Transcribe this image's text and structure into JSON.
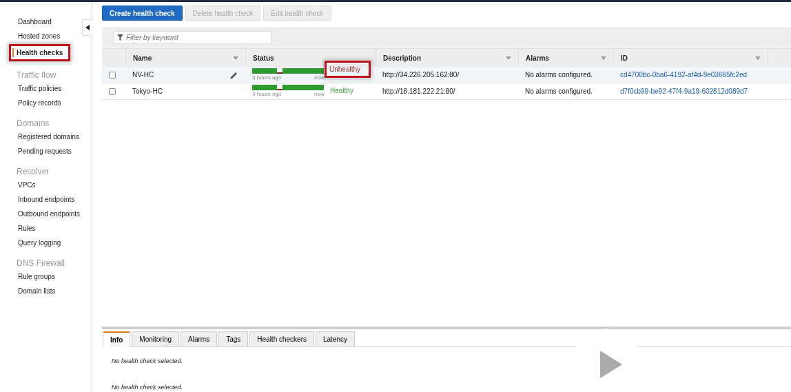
{
  "sidebar": {
    "items": [
      {
        "kind": "link",
        "label": "Dashboard",
        "selected": false,
        "highlighted": false
      },
      {
        "kind": "link",
        "label": "Hosted zones",
        "selected": false,
        "highlighted": false
      },
      {
        "kind": "link",
        "label": "Health checks",
        "selected": true,
        "highlighted": true
      },
      {
        "kind": "heading",
        "label": "Traffic flow"
      },
      {
        "kind": "link",
        "label": "Traffic policies",
        "selected": false,
        "highlighted": false
      },
      {
        "kind": "link",
        "label": "Policy records",
        "selected": false,
        "highlighted": false
      },
      {
        "kind": "heading",
        "label": "Domains"
      },
      {
        "kind": "link",
        "label": "Registered domains",
        "selected": false,
        "highlighted": false
      },
      {
        "kind": "link",
        "label": "Pending requests",
        "selected": false,
        "highlighted": false
      },
      {
        "kind": "heading",
        "label": "Resolver"
      },
      {
        "kind": "link",
        "label": "VPCs",
        "selected": false,
        "highlighted": false
      },
      {
        "kind": "link",
        "label": "Inbound endpoints",
        "selected": false,
        "highlighted": false
      },
      {
        "kind": "link",
        "label": "Outbound endpoints",
        "selected": false,
        "highlighted": false
      },
      {
        "kind": "link",
        "label": "Rules",
        "selected": false,
        "highlighted": false
      },
      {
        "kind": "link",
        "label": "Query logging",
        "selected": false,
        "highlighted": false
      },
      {
        "kind": "heading",
        "label": "DNS Firewall"
      },
      {
        "kind": "link",
        "label": "Rule groups",
        "selected": false,
        "highlighted": false
      },
      {
        "kind": "link",
        "label": "Domain lists",
        "selected": false,
        "highlighted": false
      }
    ]
  },
  "toolbar": {
    "buttons": [
      {
        "label": "Create health check",
        "disabled": false
      },
      {
        "label": "Delete health check",
        "disabled": true
      },
      {
        "label": "Edit health check",
        "disabled": true
      }
    ]
  },
  "filter": {
    "placeholder": "Filter by keyword"
  },
  "table": {
    "columns": [
      "Name",
      "Status",
      "Description",
      "Alarms",
      "ID"
    ],
    "rows": [
      {
        "checked": false,
        "name": "NV-HC",
        "editable": true,
        "status": {
          "kind": "unhealthy",
          "label": "Unhealthy",
          "highlighted": true,
          "from": "3 hours ago",
          "to": "now"
        },
        "description": "http://34.226.205.162:80/",
        "alarms": "No alarms configured.",
        "id": "cd4700bc-0ba6-4192-af4d-9e03665fc2ed"
      },
      {
        "checked": false,
        "name": "Tokyo-HC",
        "editable": false,
        "status": {
          "kind": "healthy",
          "label": "Healthy",
          "highlighted": false,
          "from": "3 hours ago",
          "to": "now"
        },
        "description": "http://18.181.222.21:80/",
        "alarms": "No alarms configured.",
        "id": "d7f0cb99-be92-47f4-9a19-602812d089d7"
      }
    ]
  },
  "details": {
    "tabs": [
      {
        "label": "Info",
        "selected": true
      },
      {
        "label": "Monitoring",
        "selected": false
      },
      {
        "label": "Alarms",
        "selected": false
      },
      {
        "label": "Tags",
        "selected": false
      },
      {
        "label": "Health checkers",
        "selected": false
      },
      {
        "label": "Latency",
        "selected": false
      }
    ],
    "messages": [
      "No health check selected.",
      "No health check selected."
    ]
  }
}
